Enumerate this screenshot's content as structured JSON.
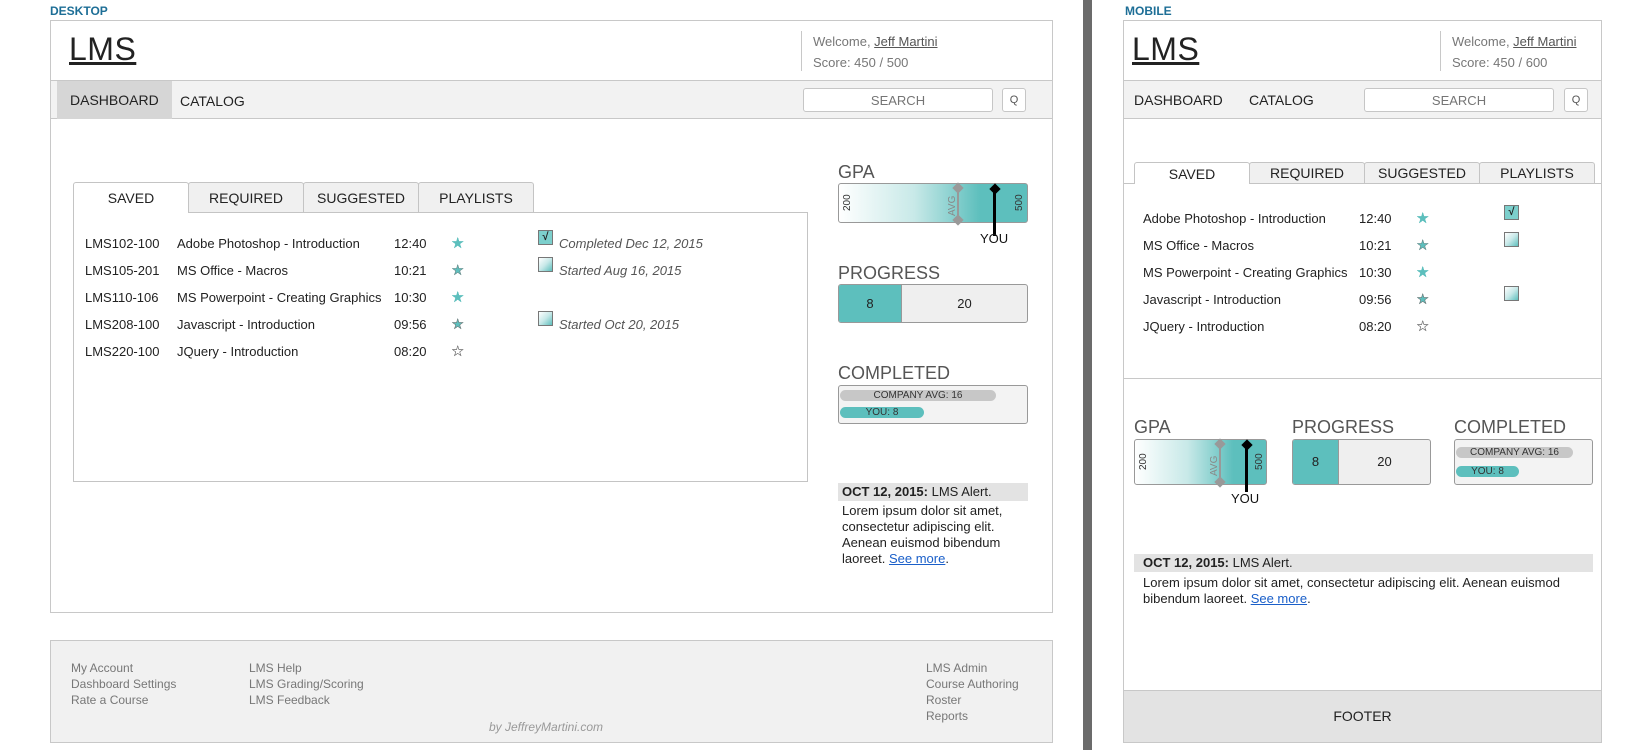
{
  "desktop": {
    "section_label": "DESKTOP",
    "header": {
      "logo": "LMS",
      "welcome_prefix": "Welcome, ",
      "user_name": "Jeff Martini",
      "score": "Score: 450 / 500"
    },
    "nav": {
      "dashboard": "DASHBOARD",
      "catalog": "CATALOG",
      "search_placeholder": "SEARCH",
      "search_button": "Q"
    },
    "tabs": [
      "SAVED",
      "REQUIRED",
      "SUGGESTED",
      "PLAYLISTS"
    ],
    "courses": [
      {
        "code": "LMS102-100",
        "title": "Adobe Photoshop - Introduction",
        "time": "12:40",
        "rating": 4,
        "status": "completed",
        "status_text": "Completed Dec 12, 2015"
      },
      {
        "code": "LMS105-201",
        "title": "MS Office - Macros",
        "time": "10:21",
        "rating": 3,
        "status": "started",
        "status_text": "Started Aug 16, 2015"
      },
      {
        "code": "LMS110-106",
        "title": "MS Powerpoint - Creating Graphics",
        "time": "10:30",
        "rating": 4,
        "status": "none",
        "status_text": ""
      },
      {
        "code": "LMS208-100",
        "title": "Javascript - Introduction",
        "time": "09:56",
        "rating": 2,
        "status": "started",
        "status_text": "Started Oct 20, 2015"
      },
      {
        "code": "LMS220-100",
        "title": "JQuery - Introduction",
        "time": "08:20",
        "rating": 0,
        "status": "none",
        "status_text": ""
      }
    ],
    "gpa": {
      "title": "GPA",
      "min_label": "200",
      "max_label": "500",
      "avg_label": "AVG",
      "you_label": "YOU"
    },
    "progress": {
      "title": "PROGRESS",
      "done": "8",
      "total": "20"
    },
    "completed": {
      "title": "COMPLETED",
      "company_label": "COMPANY AVG: 16",
      "you_label": "YOU: 8"
    },
    "alert": {
      "date": "OCT 12, 2015:",
      "title": " LMS Alert.",
      "body": "Lorem ipsum dolor sit amet, consectetur adipiscing elit. Aenean euismod bibendum laoreet. ",
      "link": "See more"
    },
    "footer": {
      "col1": [
        "My Account",
        "Dashboard Settings",
        "Rate a Course"
      ],
      "col2": [
        "LMS Help",
        "LMS Grading/Scoring",
        "LMS Feedback"
      ],
      "col3": [
        "LMS Admin",
        "Course Authoring",
        "Roster",
        "Reports"
      ],
      "credit": "by JeffreyMartini.com"
    }
  },
  "mobile": {
    "section_label": "MOBILE",
    "header": {
      "logo": "LMS",
      "welcome_prefix": "Welcome, ",
      "user_name": "Jeff Martini",
      "score": "Score: 450 / 600"
    },
    "nav": {
      "dashboard": "DASHBOARD",
      "catalog": "CATALOG",
      "search_placeholder": "SEARCH",
      "search_button": "Q"
    },
    "tabs": [
      "SAVED",
      "REQUIRED",
      "SUGGESTED",
      "PLAYLISTS"
    ],
    "courses": [
      {
        "title": "Adobe Photoshop - Introduction",
        "time": "12:40",
        "rating": 4,
        "status": "completed"
      },
      {
        "title": "MS Office - Macros",
        "time": "10:21",
        "rating": 3,
        "status": "started"
      },
      {
        "title": "MS Powerpoint - Creating Graphics",
        "time": "10:30",
        "rating": 4,
        "status": "none"
      },
      {
        "title": "Javascript - Introduction",
        "time": "09:56",
        "rating": 2,
        "status": "started"
      },
      {
        "title": "JQuery - Introduction",
        "time": "08:20",
        "rating": 0,
        "status": "none"
      }
    ],
    "gpa": {
      "title": "GPA",
      "min_label": "200",
      "max_label": "500",
      "avg_label": "AVG",
      "you_label": "YOU"
    },
    "progress": {
      "title": "PROGRESS",
      "done": "8",
      "total": "20"
    },
    "completed": {
      "title": "COMPLETED",
      "company_label": "COMPANY AVG: 16",
      "you_label": "YOU: 8"
    },
    "alert": {
      "date": "OCT 12, 2015:",
      "title": " LMS Alert.",
      "body": "Lorem ipsum dolor sit amet, consectetur adipiscing elit. Aenean euismod bibendum laoreet. ",
      "link": "See more"
    },
    "footer": {
      "label": "FOOTER"
    }
  },
  "icons": {
    "check": "√",
    "star": "★",
    "star_off": "☆"
  },
  "colors": {
    "accent": "#5dbfbd",
    "label_blue": "#1d6e96",
    "link": "#1a5fc9"
  }
}
